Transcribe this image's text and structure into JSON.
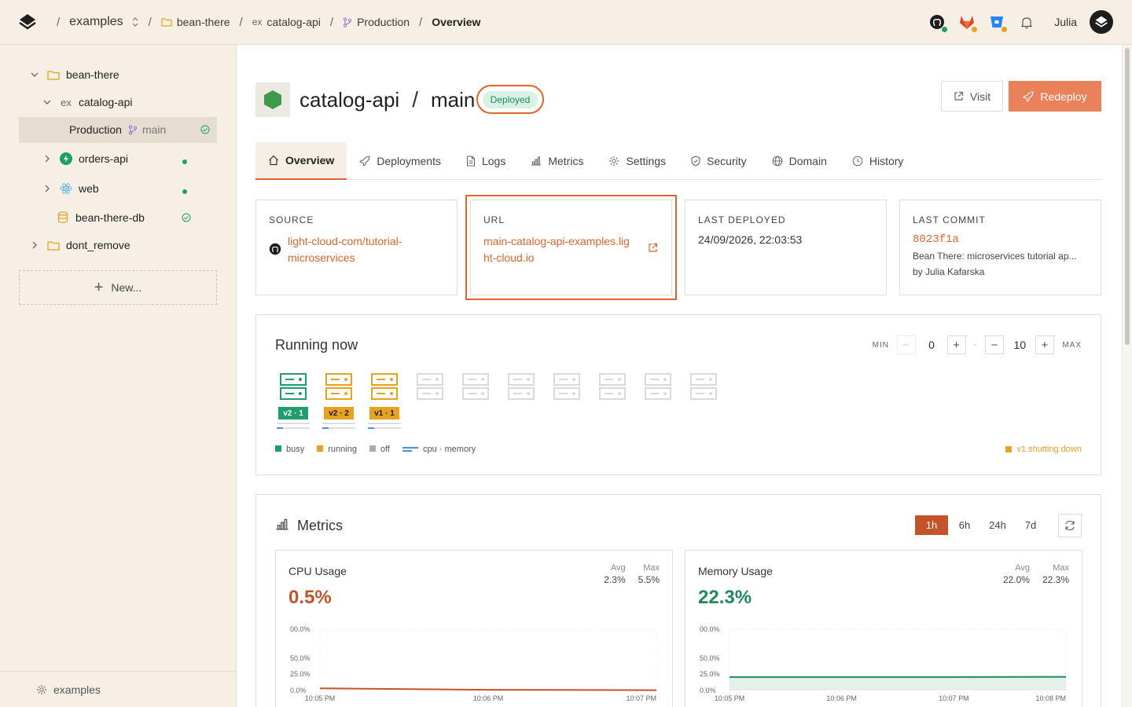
{
  "breadcrumb": {
    "workspace": "examples",
    "project": "bean-there",
    "service": "catalog-api",
    "environment": "Production",
    "page": "Overview"
  },
  "user": {
    "name": "Julia"
  },
  "sidebar": {
    "project": "bean-there",
    "service": "catalog-api",
    "env_label": "Production",
    "env_branch": "main",
    "services": [
      {
        "label": "orders-api"
      },
      {
        "label": "web"
      }
    ],
    "db": "bean-there-db",
    "folder2": "dont_remove",
    "new_label": "New...",
    "footer": "examples"
  },
  "header": {
    "service": "catalog-api",
    "branch": "main",
    "status": "Deployed",
    "visit": "Visit",
    "redeploy": "Redeploy"
  },
  "tabs": [
    "Overview",
    "Deployments",
    "Logs",
    "Metrics",
    "Settings",
    "Security",
    "Domain",
    "History"
  ],
  "cards": {
    "source_label": "SOURCE",
    "source_line1": "light-cloud-com/tutorial-",
    "source_line2": "microservices",
    "url_label": "URL",
    "url_line1": "main-catalog-api-examples.lig",
    "url_line2": "ht-cloud.io",
    "deployed_label": "LAST DEPLOYED",
    "deployed_value": "24/09/2026, 22:03:53",
    "commit_label": "LAST COMMIT",
    "commit_hash": "8023f1a",
    "commit_message": "Bean There: microservices tutorial ap...",
    "commit_author": "by Julia Kafarska"
  },
  "running": {
    "title": "Running now",
    "min_label": "MIN",
    "min_value": "0",
    "max_label": "MAX",
    "max_value": "10",
    "dash": "-",
    "instances": [
      {
        "label": "v2 · 1",
        "state": "busy",
        "cpu": 0.2
      },
      {
        "label": "v2 · 2",
        "state": "running",
        "cpu": 0.2
      },
      {
        "label": "v1 · 1",
        "state": "running",
        "cpu": 0.2
      },
      {
        "state": "off"
      },
      {
        "state": "off"
      },
      {
        "state": "off"
      },
      {
        "state": "off"
      },
      {
        "state": "off"
      },
      {
        "state": "off"
      },
      {
        "state": "off"
      }
    ],
    "legend_busy": "busy",
    "legend_running": "running",
    "legend_off": "off",
    "legend_cpu": "cpu · memory",
    "shutting_down": "v1 shutting down"
  },
  "metrics": {
    "title": "Metrics",
    "ranges": [
      "1h",
      "6h",
      "24h",
      "7d"
    ],
    "active_range": "1h",
    "cpu": {
      "title": "CPU Usage",
      "current": "0.5%",
      "avg_label": "Avg",
      "avg": "2.3%",
      "max_label": "Max",
      "max": "5.5%",
      "y_ticks": [
        "00.0%",
        "50.0%",
        "25.0%",
        "0.0%"
      ],
      "x_ticks": [
        "10:05 PM",
        "10:06 PM",
        "10:07 PM"
      ]
    },
    "memory": {
      "title": "Memory Usage",
      "current": "22.3%",
      "avg_label": "Avg",
      "avg": "22.0%",
      "max_label": "Max",
      "max": "22.3%",
      "y_ticks": [
        "00.0%",
        "50.0%",
        "25.0%",
        "0.0%"
      ],
      "x_ticks": [
        "10:05 PM",
        "10:06 PM",
        "10:07 PM",
        "10:08 PM"
      ]
    }
  },
  "chart_data": [
    {
      "type": "line",
      "title": "CPU Usage",
      "x": [
        "10:05 PM",
        "10:06 PM",
        "10:07 PM"
      ],
      "series": [
        {
          "values": [
            3.5,
            1.2,
            0.5
          ]
        }
      ],
      "ylim": [
        0,
        100
      ]
    },
    {
      "type": "area",
      "title": "Memory Usage",
      "x": [
        "10:05 PM",
        "10:06 PM",
        "10:07 PM",
        "10:08 PM"
      ],
      "series": [
        {
          "values": [
            22.0,
            22.0,
            22.0,
            22.3
          ]
        }
      ],
      "ylim": [
        0,
        100
      ]
    }
  ],
  "colors": {
    "accent": "#e0652b",
    "busy": "#1e9e6a",
    "running": "#e8a221",
    "off": "#c8c8c8",
    "cpu_line": "#4a90e2"
  }
}
